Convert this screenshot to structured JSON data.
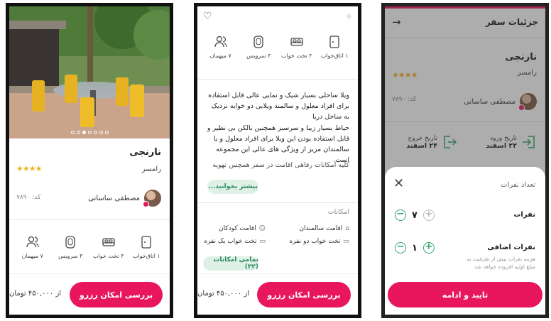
{
  "colors": {
    "accent": "#e8175d",
    "green": "#2fa56a",
    "star": "#f1b31c"
  },
  "listing": {
    "title": "نارنجی",
    "city": "رامسر",
    "stars": "★★★★",
    "code": "کد: ۷۸۹۰",
    "host_name": "مصطفی ساسانی"
  },
  "gallery": {
    "dot_count": 7,
    "active_dot": 2
  },
  "features": [
    {
      "icon": "door-icon",
      "label": "۱ اتاق‌خواب"
    },
    {
      "icon": "bed-icon",
      "label": "۳ تخت خواب"
    },
    {
      "icon": "toilet-icon",
      "label": "۳ سرویس"
    },
    {
      "icon": "guests-icon",
      "label": "۷ میهمان"
    }
  ],
  "booking": {
    "cta": "بررسی امکان رزرو",
    "price": "از ۴۵۰,۰۰۰ تومان"
  },
  "details": {
    "para1": "ویلا ساحلی بسیار شیک و نمایی عالی قابل استفاده برای افراد معلول و سالمند ویلایی دو خوابه نزدیک به ساحل دریا",
    "para2": "حیاط بسیار زیبا و سرسبز همچنین بالکن بی نظیر و قابل استفاده بودن این ویلا برای افراد معلول و یا سالمندان مزیز از ویژگی های عالی این مجموعه است.",
    "para3": "کلیه امکانات رفاهی اقامت در سفر همچنین تهویه",
    "read_more": "بیشتر بخوانید...",
    "amenities_label": "امکانات",
    "amenities": [
      {
        "icon": "elderly-icon",
        "label": "اقامت سالمندان"
      },
      {
        "icon": "child-icon",
        "label": "اقامت کودکان"
      },
      {
        "icon": "double-bed-icon",
        "label": "تخت خواب دو نفره"
      },
      {
        "icon": "single-bed-icon",
        "label": "تخت خواب یک نفره"
      }
    ],
    "all_amenities": "تمامی امکانات (۳۲)"
  },
  "trip": {
    "header": "جزئیات سفر",
    "checkin_label": "تاریخ ورود",
    "checkin_date": "۲۲ اسفند",
    "checkout_label": "تاریخ خروج",
    "checkout_date": "۲۴ اسفند"
  },
  "guests_sheet": {
    "title": "تعداد نفرات",
    "people_label": "نفرات",
    "people_value": "۷",
    "extra_label": "نفرات اضافی",
    "extra_value": "۱",
    "extra_hint": "هزینه نفرات بیش از ظرفیت به مبلغ اولیه افزوده خواهد شد",
    "confirm": "تایید و ادامه"
  }
}
